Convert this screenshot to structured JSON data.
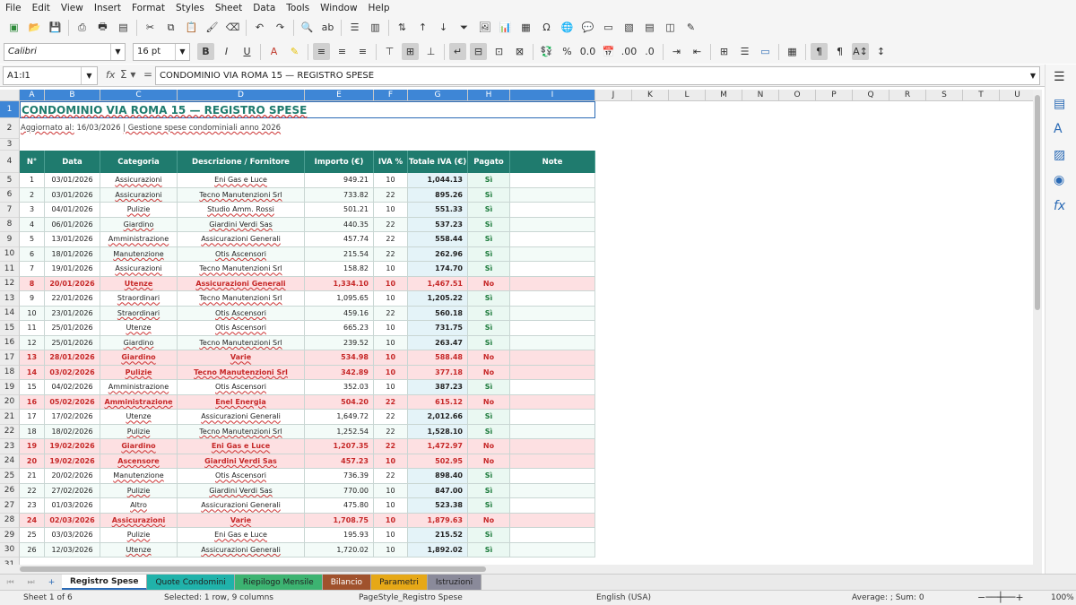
{
  "menu": [
    "File",
    "Edit",
    "View",
    "Insert",
    "Format",
    "Styles",
    "Sheet",
    "Data",
    "Tools",
    "Window",
    "Help"
  ],
  "font_name": "Calibri",
  "font_size": "16 pt",
  "formula_bar": {
    "name_box": "A1:I1",
    "content": "CONDOMINIO VIA ROMA 15 — REGISTRO SPESE"
  },
  "columns": [
    "A",
    "B",
    "C",
    "D",
    "E",
    "F",
    "G",
    "H",
    "I",
    "J",
    "K",
    "L",
    "M",
    "N",
    "O",
    "P",
    "Q",
    "R",
    "S",
    "T",
    "U"
  ],
  "sheet": {
    "title": "CONDOMINIO VIA ROMA 15 — REGISTRO SPESE",
    "subtitle_label": "Aggiornato al:",
    "subtitle_date": "16/03/2026",
    "subtitle_rest": "|  Gestione spese condominiali anno 2026",
    "headers": [
      "N°",
      "Data",
      "Categoria",
      "Descrizione / Fornitore",
      "Importo (€)",
      "IVA %",
      "Totale IVA (€)",
      "Pagato",
      "Note"
    ],
    "rows": [
      [
        "1",
        "03/01/2026",
        "Assicurazioni",
        "Eni Gas e Luce",
        "949.21",
        "10",
        "1,044.13",
        "Sì",
        ""
      ],
      [
        "2",
        "03/01/2026",
        "Assicurazioni",
        "Tecno Manutenzioni Srl",
        "733.82",
        "22",
        "895.26",
        "Sì",
        ""
      ],
      [
        "3",
        "04/01/2026",
        "Pulizie",
        "Studio Amm. Rossi",
        "501.21",
        "10",
        "551.33",
        "Sì",
        ""
      ],
      [
        "4",
        "06/01/2026",
        "Giardino",
        "Giardini Verdi Sas",
        "440.35",
        "22",
        "537.23",
        "Sì",
        ""
      ],
      [
        "5",
        "13/01/2026",
        "Amministrazione",
        "Assicurazioni Generali",
        "457.74",
        "22",
        "558.44",
        "Sì",
        ""
      ],
      [
        "6",
        "18/01/2026",
        "Manutenzione",
        "Otis Ascensori",
        "215.54",
        "22",
        "262.96",
        "Sì",
        ""
      ],
      [
        "7",
        "19/01/2026",
        "Assicurazioni",
        "Tecno Manutenzioni Srl",
        "158.82",
        "10",
        "174.70",
        "Sì",
        ""
      ],
      [
        "8",
        "20/01/2026",
        "Utenze",
        "Assicurazioni Generali",
        "1,334.10",
        "10",
        "1,467.51",
        "No",
        ""
      ],
      [
        "9",
        "22/01/2026",
        "Straordinari",
        "Tecno Manutenzioni Srl",
        "1,095.65",
        "10",
        "1,205.22",
        "Sì",
        ""
      ],
      [
        "10",
        "23/01/2026",
        "Straordinari",
        "Otis Ascensori",
        "459.16",
        "22",
        "560.18",
        "Sì",
        ""
      ],
      [
        "11",
        "25/01/2026",
        "Utenze",
        "Otis Ascensori",
        "665.23",
        "10",
        "731.75",
        "Sì",
        ""
      ],
      [
        "12",
        "25/01/2026",
        "Giardino",
        "Tecno Manutenzioni Srl",
        "239.52",
        "10",
        "263.47",
        "Sì",
        ""
      ],
      [
        "13",
        "28/01/2026",
        "Giardino",
        "Varie",
        "534.98",
        "10",
        "588.48",
        "No",
        ""
      ],
      [
        "14",
        "03/02/2026",
        "Pulizie",
        "Tecno Manutenzioni Srl",
        "342.89",
        "10",
        "377.18",
        "No",
        ""
      ],
      [
        "15",
        "04/02/2026",
        "Amministrazione",
        "Otis Ascensori",
        "352.03",
        "10",
        "387.23",
        "Sì",
        ""
      ],
      [
        "16",
        "05/02/2026",
        "Amministrazione",
        "Enel Energia",
        "504.20",
        "22",
        "615.12",
        "No",
        ""
      ],
      [
        "17",
        "17/02/2026",
        "Utenze",
        "Assicurazioni Generali",
        "1,649.72",
        "22",
        "2,012.66",
        "Sì",
        ""
      ],
      [
        "18",
        "18/02/2026",
        "Pulizie",
        "Tecno Manutenzioni Srl",
        "1,252.54",
        "22",
        "1,528.10",
        "Sì",
        ""
      ],
      [
        "19",
        "19/02/2026",
        "Giardino",
        "Eni Gas e Luce",
        "1,207.35",
        "22",
        "1,472.97",
        "No",
        ""
      ],
      [
        "20",
        "19/02/2026",
        "Ascensore",
        "Giardini Verdi Sas",
        "457.23",
        "10",
        "502.95",
        "No",
        ""
      ],
      [
        "21",
        "20/02/2026",
        "Manutenzione",
        "Otis Ascensori",
        "736.39",
        "22",
        "898.40",
        "Sì",
        ""
      ],
      [
        "22",
        "27/02/2026",
        "Pulizie",
        "Giardini Verdi Sas",
        "770.00",
        "10",
        "847.00",
        "Sì",
        ""
      ],
      [
        "23",
        "01/03/2026",
        "Altro",
        "Assicurazioni Generali",
        "475.80",
        "10",
        "523.38",
        "Sì",
        ""
      ],
      [
        "24",
        "02/03/2026",
        "Assicurazioni",
        "Varie",
        "1,708.75",
        "10",
        "1,879.63",
        "No",
        ""
      ],
      [
        "25",
        "03/03/2026",
        "Pulizie",
        "Eni Gas e Luce",
        "195.93",
        "10",
        "215.52",
        "Sì",
        ""
      ],
      [
        "26",
        "12/03/2026",
        "Utenze",
        "Assicurazioni Generali",
        "1,720.02",
        "10",
        "1,892.02",
        "Sì",
        ""
      ]
    ]
  },
  "tabs": [
    {
      "label": "Registro Spese",
      "color": "#ffffff"
    },
    {
      "label": "Quote Condomini",
      "color": "#20b2aa"
    },
    {
      "label": "Riepilogo Mensile",
      "color": "#3cb371"
    },
    {
      "label": "Bilancio",
      "color": "#a0522d"
    },
    {
      "label": "Parametri",
      "color": "#e6a817"
    },
    {
      "label": "Istruzioni",
      "color": "#8a8a9a"
    }
  ],
  "status": {
    "sheet": "Sheet 1 of 6",
    "selection": "Selected: 1 row, 9 columns",
    "page_style": "PageStyle_Registro Spese",
    "language": "English (USA)",
    "sum": "Average: ; Sum: 0",
    "zoom": "100%"
  },
  "colors": {
    "header_bg": "#1f7b6e",
    "unpaid_bg": "#fde0e2",
    "unpaid_text": "#c62828",
    "paid_bg": "#eaf8f2",
    "total_bg": "#e4f3f8"
  }
}
